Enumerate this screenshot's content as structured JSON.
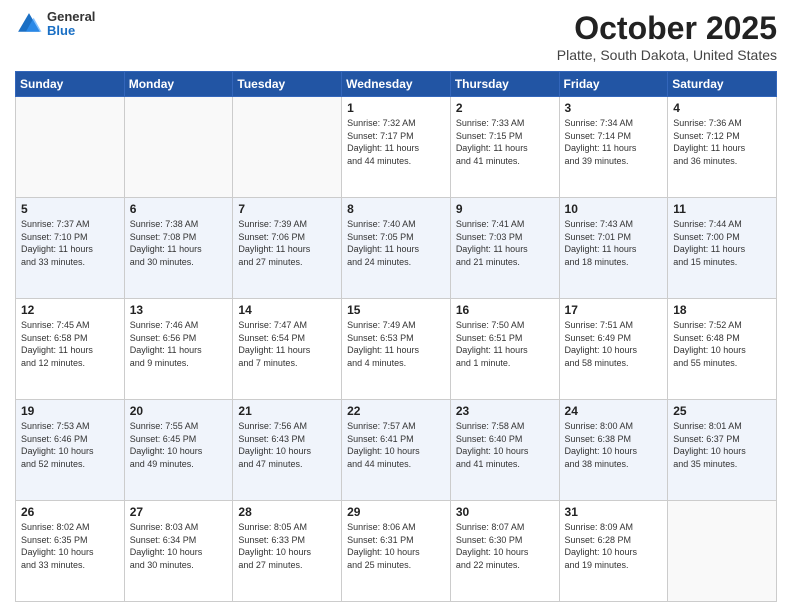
{
  "header": {
    "logo_line1": "General",
    "logo_line2": "Blue",
    "title": "October 2025",
    "subtitle": "Platte, South Dakota, United States"
  },
  "weekdays": [
    "Sunday",
    "Monday",
    "Tuesday",
    "Wednesday",
    "Thursday",
    "Friday",
    "Saturday"
  ],
  "weeks": [
    [
      {
        "day": "",
        "info": ""
      },
      {
        "day": "",
        "info": ""
      },
      {
        "day": "",
        "info": ""
      },
      {
        "day": "1",
        "info": "Sunrise: 7:32 AM\nSunset: 7:17 PM\nDaylight: 11 hours\nand 44 minutes."
      },
      {
        "day": "2",
        "info": "Sunrise: 7:33 AM\nSunset: 7:15 PM\nDaylight: 11 hours\nand 41 minutes."
      },
      {
        "day": "3",
        "info": "Sunrise: 7:34 AM\nSunset: 7:14 PM\nDaylight: 11 hours\nand 39 minutes."
      },
      {
        "day": "4",
        "info": "Sunrise: 7:36 AM\nSunset: 7:12 PM\nDaylight: 11 hours\nand 36 minutes."
      }
    ],
    [
      {
        "day": "5",
        "info": "Sunrise: 7:37 AM\nSunset: 7:10 PM\nDaylight: 11 hours\nand 33 minutes."
      },
      {
        "day": "6",
        "info": "Sunrise: 7:38 AM\nSunset: 7:08 PM\nDaylight: 11 hours\nand 30 minutes."
      },
      {
        "day": "7",
        "info": "Sunrise: 7:39 AM\nSunset: 7:06 PM\nDaylight: 11 hours\nand 27 minutes."
      },
      {
        "day": "8",
        "info": "Sunrise: 7:40 AM\nSunset: 7:05 PM\nDaylight: 11 hours\nand 24 minutes."
      },
      {
        "day": "9",
        "info": "Sunrise: 7:41 AM\nSunset: 7:03 PM\nDaylight: 11 hours\nand 21 minutes."
      },
      {
        "day": "10",
        "info": "Sunrise: 7:43 AM\nSunset: 7:01 PM\nDaylight: 11 hours\nand 18 minutes."
      },
      {
        "day": "11",
        "info": "Sunrise: 7:44 AM\nSunset: 7:00 PM\nDaylight: 11 hours\nand 15 minutes."
      }
    ],
    [
      {
        "day": "12",
        "info": "Sunrise: 7:45 AM\nSunset: 6:58 PM\nDaylight: 11 hours\nand 12 minutes."
      },
      {
        "day": "13",
        "info": "Sunrise: 7:46 AM\nSunset: 6:56 PM\nDaylight: 11 hours\nand 9 minutes."
      },
      {
        "day": "14",
        "info": "Sunrise: 7:47 AM\nSunset: 6:54 PM\nDaylight: 11 hours\nand 7 minutes."
      },
      {
        "day": "15",
        "info": "Sunrise: 7:49 AM\nSunset: 6:53 PM\nDaylight: 11 hours\nand 4 minutes."
      },
      {
        "day": "16",
        "info": "Sunrise: 7:50 AM\nSunset: 6:51 PM\nDaylight: 11 hours\nand 1 minute."
      },
      {
        "day": "17",
        "info": "Sunrise: 7:51 AM\nSunset: 6:49 PM\nDaylight: 10 hours\nand 58 minutes."
      },
      {
        "day": "18",
        "info": "Sunrise: 7:52 AM\nSunset: 6:48 PM\nDaylight: 10 hours\nand 55 minutes."
      }
    ],
    [
      {
        "day": "19",
        "info": "Sunrise: 7:53 AM\nSunset: 6:46 PM\nDaylight: 10 hours\nand 52 minutes."
      },
      {
        "day": "20",
        "info": "Sunrise: 7:55 AM\nSunset: 6:45 PM\nDaylight: 10 hours\nand 49 minutes."
      },
      {
        "day": "21",
        "info": "Sunrise: 7:56 AM\nSunset: 6:43 PM\nDaylight: 10 hours\nand 47 minutes."
      },
      {
        "day": "22",
        "info": "Sunrise: 7:57 AM\nSunset: 6:41 PM\nDaylight: 10 hours\nand 44 minutes."
      },
      {
        "day": "23",
        "info": "Sunrise: 7:58 AM\nSunset: 6:40 PM\nDaylight: 10 hours\nand 41 minutes."
      },
      {
        "day": "24",
        "info": "Sunrise: 8:00 AM\nSunset: 6:38 PM\nDaylight: 10 hours\nand 38 minutes."
      },
      {
        "day": "25",
        "info": "Sunrise: 8:01 AM\nSunset: 6:37 PM\nDaylight: 10 hours\nand 35 minutes."
      }
    ],
    [
      {
        "day": "26",
        "info": "Sunrise: 8:02 AM\nSunset: 6:35 PM\nDaylight: 10 hours\nand 33 minutes."
      },
      {
        "day": "27",
        "info": "Sunrise: 8:03 AM\nSunset: 6:34 PM\nDaylight: 10 hours\nand 30 minutes."
      },
      {
        "day": "28",
        "info": "Sunrise: 8:05 AM\nSunset: 6:33 PM\nDaylight: 10 hours\nand 27 minutes."
      },
      {
        "day": "29",
        "info": "Sunrise: 8:06 AM\nSunset: 6:31 PM\nDaylight: 10 hours\nand 25 minutes."
      },
      {
        "day": "30",
        "info": "Sunrise: 8:07 AM\nSunset: 6:30 PM\nDaylight: 10 hours\nand 22 minutes."
      },
      {
        "day": "31",
        "info": "Sunrise: 8:09 AM\nSunset: 6:28 PM\nDaylight: 10 hours\nand 19 minutes."
      },
      {
        "day": "",
        "info": ""
      }
    ]
  ]
}
